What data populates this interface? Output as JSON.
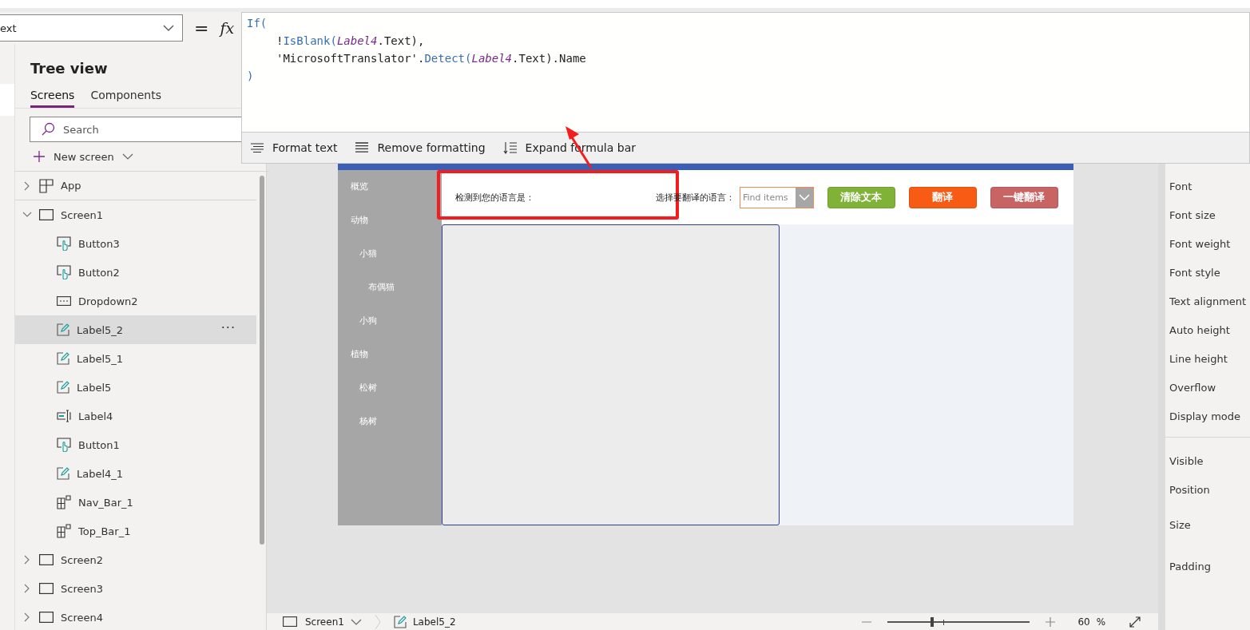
{
  "formula_bar": {
    "property": "ext",
    "equals": "=",
    "fx": "fx",
    "code_lines": [
      {
        "indent": false,
        "tokens": [
          {
            "text": "If(",
            "kind": "function"
          }
        ]
      },
      {
        "indent": true,
        "tokens": [
          {
            "text": "!",
            "kind": "plain"
          },
          {
            "text": "IsBlank(",
            "kind": "function"
          },
          {
            "text": "Label4",
            "kind": "reference"
          },
          {
            "text": ".Text),",
            "kind": "plain"
          }
        ]
      },
      {
        "indent": true,
        "tokens": [
          {
            "text": "'MicrosoftTranslator'.",
            "kind": "plain"
          },
          {
            "text": "Detect(",
            "kind": "function"
          },
          {
            "text": "Label4",
            "kind": "reference"
          },
          {
            "text": ".Text).Name",
            "kind": "plain"
          }
        ]
      },
      {
        "indent": false,
        "tokens": [
          {
            "text": ")",
            "kind": "function"
          }
        ]
      }
    ],
    "tools": [
      {
        "kind": "format",
        "label": "Format text"
      },
      {
        "kind": "remove",
        "label": "Remove formatting"
      },
      {
        "kind": "expand",
        "label": "Expand formula bar"
      }
    ]
  },
  "tree": {
    "title": "Tree view",
    "tabs": [
      {
        "label": "Screens",
        "selected": true
      },
      {
        "label": "Components",
        "selected": false
      }
    ],
    "search": {
      "placeholder": "Search"
    },
    "new_screen": "New screen",
    "items": [
      {
        "label": "App",
        "kind": "app",
        "expanded": false,
        "selected": false
      },
      {
        "label": "Screen1",
        "kind": "screen",
        "expanded": true,
        "selected": false,
        "children": [
          {
            "label": "Button3",
            "kind": "button",
            "selected": false
          },
          {
            "label": "Button2",
            "kind": "button",
            "selected": false
          },
          {
            "label": "Dropdown2",
            "kind": "dropdown",
            "selected": false
          },
          {
            "label": "Label5_2",
            "kind": "label",
            "selected": true,
            "menu": "···"
          },
          {
            "label": "Label5_1",
            "kind": "label",
            "selected": false
          },
          {
            "label": "Label5",
            "kind": "label",
            "selected": false
          },
          {
            "label": "Label4",
            "kind": "input",
            "selected": false
          },
          {
            "label": "Button1",
            "kind": "button",
            "selected": false
          },
          {
            "label": "Label4_1",
            "kind": "label",
            "selected": false
          },
          {
            "label": "Nav_Bar_1",
            "kind": "group",
            "selected": false
          },
          {
            "label": "Top_Bar_1",
            "kind": "group",
            "selected": false
          }
        ]
      },
      {
        "label": "Screen2",
        "kind": "screen",
        "expanded": false,
        "selected": false
      },
      {
        "label": "Screen3",
        "kind": "screen",
        "expanded": false,
        "selected": false
      },
      {
        "label": "Screen4",
        "kind": "screen",
        "expanded": false,
        "selected": false
      }
    ]
  },
  "app_preview": {
    "nav": [
      {
        "label": "概览"
      },
      {
        "label": "动物",
        "children": [
          {
            "label": "小猫",
            "children": [
              {
                "label": "布偶猫"
              }
            ]
          },
          {
            "label": "小狗"
          }
        ]
      },
      {
        "label": "植物",
        "children": [
          {
            "label": "松树"
          },
          {
            "label": "杨树"
          }
        ]
      }
    ],
    "detected_label": "检测到您的语言是：",
    "choose_label": "选择要翻译的语言：",
    "dropdown": {
      "placeholder": "Find items"
    },
    "buttons": [
      {
        "label": "清除文本",
        "color": "#7fb236"
      },
      {
        "label": "翻译",
        "color": "#f75b14"
      },
      {
        "label": "一键翻译",
        "color": "#c86464"
      }
    ]
  },
  "properties": [
    [
      "Font",
      "Font size",
      "Font weight",
      "Font style",
      "Text alignment",
      "Auto height",
      "Line height",
      "Overflow",
      "Display mode"
    ],
    [
      "Visible",
      "Position",
      "Size",
      "Padding"
    ]
  ],
  "status_bar": {
    "screen": "Screen1",
    "control": "Label5_2",
    "zoom": {
      "level": 0.31
    },
    "zoom_value": "60",
    "zoom_unit": "%"
  }
}
